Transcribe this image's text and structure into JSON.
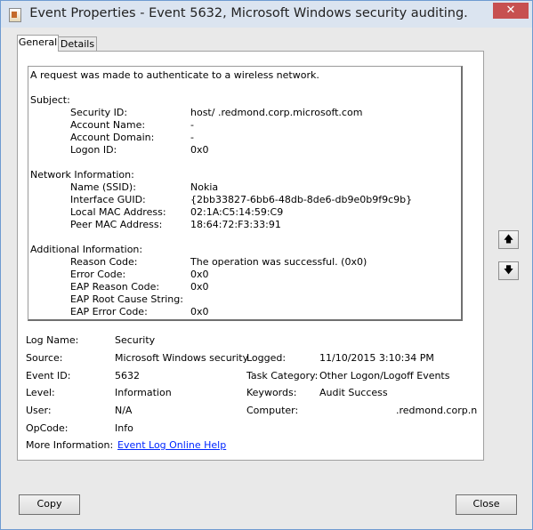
{
  "window": {
    "title": "Event Properties - Event 5632, Microsoft Windows security auditing.",
    "close_glyph": "✕"
  },
  "tabs": [
    {
      "label": "General",
      "active": true
    },
    {
      "label": "Details",
      "active": false
    }
  ],
  "message": {
    "headline": "A request was made to authenticate to a wireless network.",
    "subject_header": "Subject:",
    "subject": [
      {
        "label": "Security ID:",
        "value": "host/                              .redmond.corp.microsoft.com"
      },
      {
        "label": "Account Name:",
        "value": "-"
      },
      {
        "label": "Account Domain:",
        "value": "-"
      },
      {
        "label": "Logon ID:",
        "value": "0x0"
      }
    ],
    "network_header": "Network Information:",
    "network": [
      {
        "label": "Name (SSID):",
        "value": "Nokia"
      },
      {
        "label": "Interface GUID:",
        "value": "{2bb33827-6bb6-48db-8de6-db9e0b9f9c9b}"
      },
      {
        "label": "Local MAC Address:",
        "value": "02:1A:C5:14:59:C9"
      },
      {
        "label": "Peer MAC Address:",
        "value": "18:64:72:F3:33:91"
      }
    ],
    "additional_header": "Additional Information:",
    "additional": [
      {
        "label": "Reason Code:",
        "value": "The operation was successful. (0x0)"
      },
      {
        "label": "Error Code:",
        "value": "0x0"
      },
      {
        "label": "EAP Reason Code:",
        "value": "0x0"
      },
      {
        "label": "EAP Root Cause String:",
        "value": ""
      },
      {
        "label": "EAP Error Code:",
        "value": "0x0"
      }
    ]
  },
  "fields": {
    "log_name_label": "Log Name:",
    "log_name": "Security",
    "source_label": "Source:",
    "source": "Microsoft Windows security",
    "logged_label": "Logged:",
    "logged": "11/10/2015 3:10:34 PM",
    "event_id_label": "Event ID:",
    "event_id": "5632",
    "task_category_label": "Task Category:",
    "task_category": "Other Logon/Logoff Events",
    "level_label": "Level:",
    "level": "Information",
    "keywords_label": "Keywords:",
    "keywords": "Audit Success",
    "user_label": "User:",
    "user": "N/A",
    "computer_label": "Computer:",
    "computer": ".redmond.corp.n",
    "opcode_label": "OpCode:",
    "opcode": "Info",
    "more_info_label": "More Information:",
    "more_info_link": "Event Log Online Help"
  },
  "side_buttons": {
    "up_icon": "up-arrow-icon",
    "down_icon": "down-arrow-icon",
    "up_glyph": "🡅",
    "down_glyph": "🡇"
  },
  "buttons": {
    "copy": "Copy",
    "close": "Close"
  }
}
